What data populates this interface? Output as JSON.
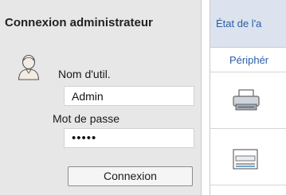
{
  "login": {
    "title": "Connexion administrateur",
    "username_label": "Nom d'util.",
    "username_value": "Admin",
    "password_label": "Mot de passe",
    "password_value": "•••••",
    "button_label": "Connexion"
  },
  "status_panel": {
    "header_title": "État de l'a",
    "tab_label": "Périphér"
  },
  "icons": {
    "avatar": "user-avatar-icon",
    "device_1": "printer-icon",
    "device_2": "scanner-icon"
  },
  "colors": {
    "link_blue": "#2a5ea8",
    "panel_gray": "#e7e7e7",
    "header_blue_gray": "#dce3ee"
  }
}
